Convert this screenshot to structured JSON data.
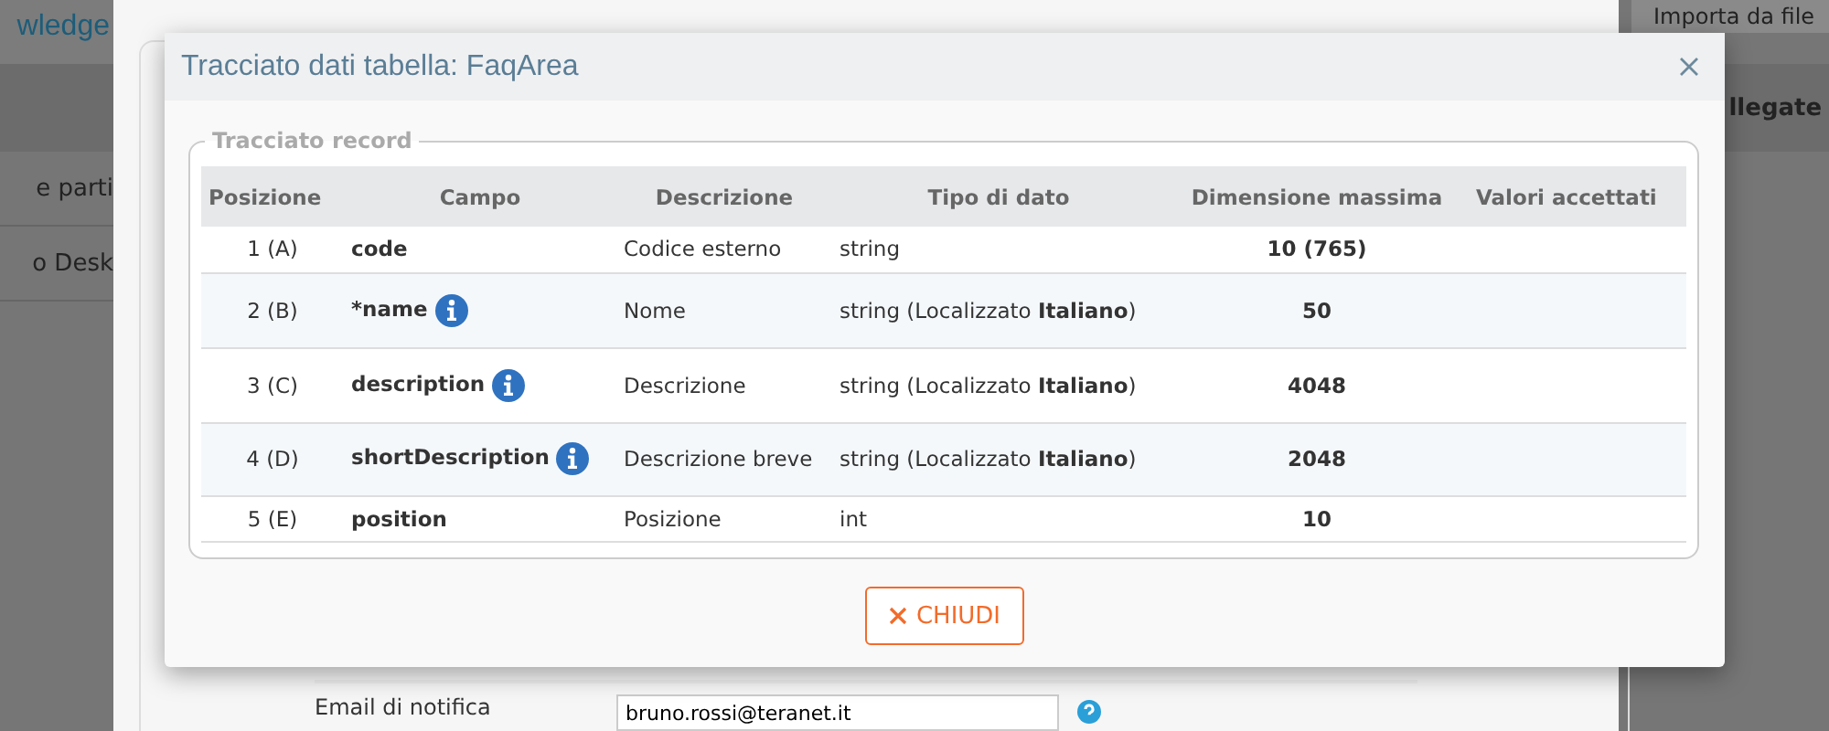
{
  "background": {
    "heading": "wledge",
    "sidebar_items": [
      "e parti",
      "o Desk"
    ],
    "import_button": "Importa da file",
    "column_header": "llegate"
  },
  "back_dialog": {
    "email_label": "Email di notifica",
    "email_value": "bruno.rossi@teranet.it"
  },
  "dialog": {
    "title": "Tracciato dati tabella: FaqArea",
    "fieldset": "Tracciato record",
    "columns": [
      "Posizione",
      "Campo",
      "Descrizione",
      "Tipo di dato",
      "Dimensione massima",
      "Valori accettati"
    ],
    "rows": [
      {
        "position": "1 (A)",
        "field": "code",
        "info": false,
        "description": "Codice esterno",
        "type": "string",
        "max_size": "10 (765)"
      },
      {
        "position": "2 (B)",
        "field": "*name",
        "info": true,
        "description": "Nome",
        "type": "string (Localizzato **Italiano**)",
        "max_size": "50"
      },
      {
        "position": "3 (C)",
        "field": "description",
        "info": true,
        "description": "Descrizione",
        "type": "string (Localizzato **Italiano**)",
        "max_size": "4048"
      },
      {
        "position": "4 (D)",
        "field": "shortDescription",
        "info": true,
        "description": "Descrizione breve",
        "type": "string (Localizzato **Italiano**)",
        "max_size": "2048"
      },
      {
        "position": "5 (E)",
        "field": "position",
        "info": false,
        "description": "Posizione",
        "type": "int",
        "max_size": "10"
      }
    ],
    "close_button": "CHIUDI"
  }
}
